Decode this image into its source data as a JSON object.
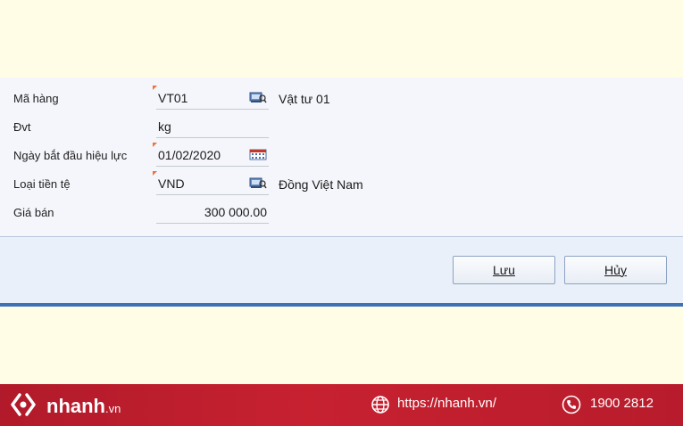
{
  "form": {
    "rows": [
      {
        "label": "Mã hàng",
        "value": "VT01",
        "description": "Vật tư 01",
        "icon": "lookup-icon"
      },
      {
        "label": "Đvt",
        "value": "kg"
      },
      {
        "label": "Ngày bắt đầu hiệu lực",
        "value": "01/02/2020",
        "icon": "calendar-icon"
      },
      {
        "label": "Loại tiền tệ",
        "value": "VND",
        "description": "Đồng Việt Nam",
        "icon": "lookup-icon"
      },
      {
        "label": "Giá bán",
        "value": "300 000.00"
      }
    ]
  },
  "buttons": {
    "save_label": "Lưu",
    "cancel_label": "Hủy"
  },
  "footer": {
    "brand": "nhanh",
    "brand_suffix": ".vn",
    "website": "https://nhanh.vn/",
    "phone": "1900 2812"
  },
  "colors": {
    "required_marker": "#e8743b",
    "footer_red": "#c72130",
    "accent_blue": "#3f72b5"
  }
}
